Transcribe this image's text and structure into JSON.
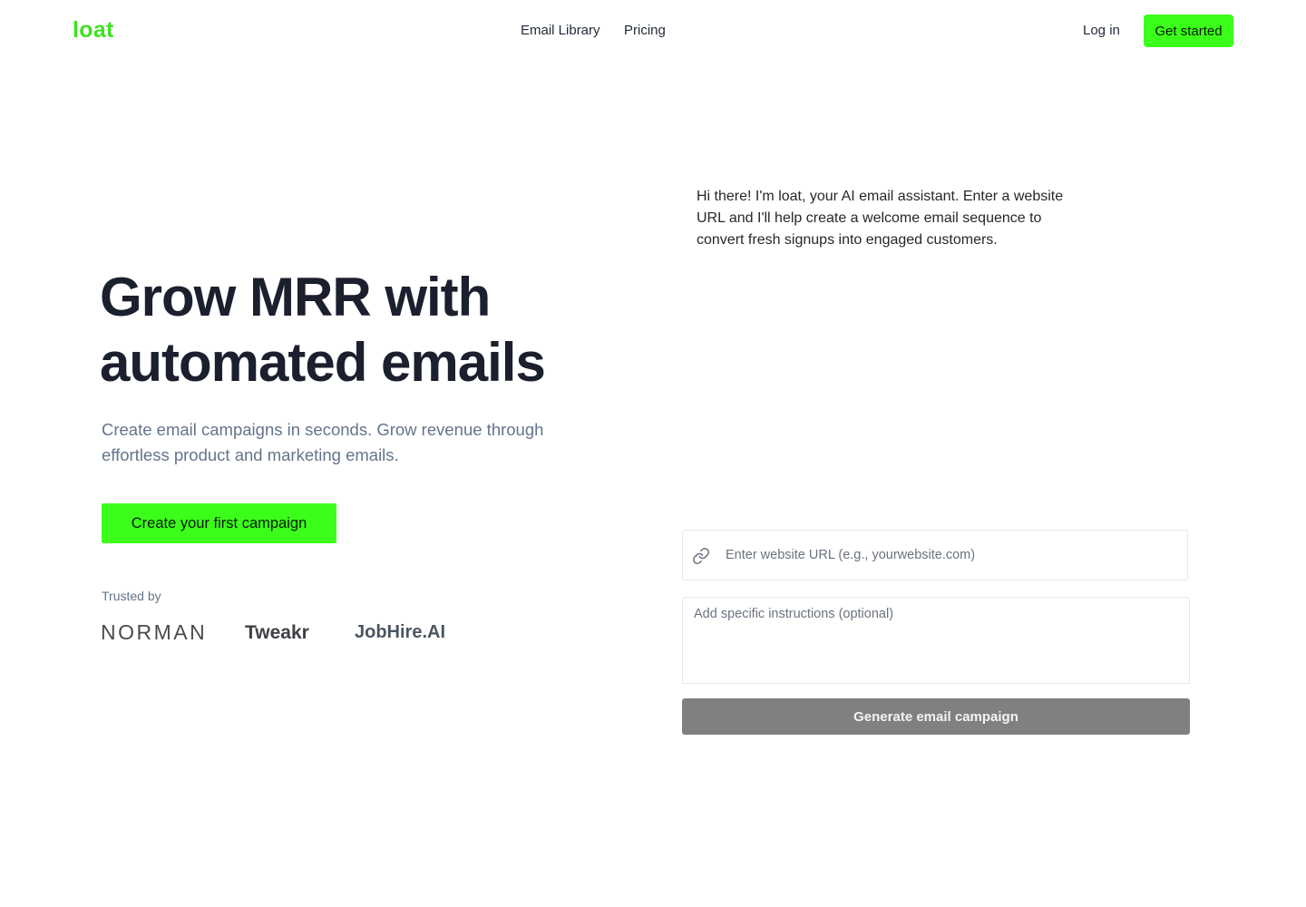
{
  "nav": {
    "logo": "loat",
    "links": [
      "Email Library",
      "Pricing"
    ],
    "login": "Log in",
    "cta": "Get started"
  },
  "hero": {
    "title_line1": "Grow MRR with",
    "title_line2": "automated emails",
    "subtitle": "Create email campaigns in seconds. Grow revenue through effortless product and marketing emails.",
    "cta": "Create your first campaign",
    "trusted_label": "Trusted by",
    "brands": [
      "NORMAN",
      "Tweakr",
      "JobHire.AI"
    ]
  },
  "assistant": {
    "message": "Hi there! I'm loat, your AI email assistant. Enter a website URL and I'll help create a welcome email sequence to convert fresh signups into engaged customers.",
    "url_placeholder": "Enter website URL (e.g., yourwebsite.com)",
    "url_value": "",
    "instructions_placeholder": "Add specific instructions (optional)",
    "instructions_value": "",
    "generate_label": "Generate email campaign"
  },
  "colors": {
    "brand_green": "#3bff1a",
    "logo_green": "#3ee21f",
    "generate_button": "#808080"
  },
  "icons": {
    "url_field_icon": "link-icon"
  }
}
